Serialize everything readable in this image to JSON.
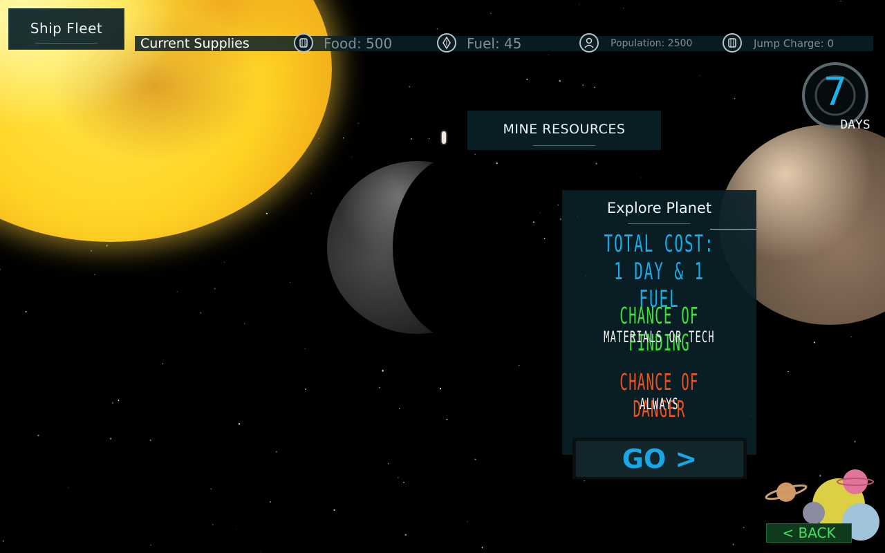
{
  "hud": {
    "ship_fleet_label": "Ship Fleet",
    "supplies_title": "Current Supplies",
    "food": "Food: 500",
    "fuel": "Fuel: 45",
    "population": "Population: 2500",
    "jump_charge": "Jump Charge: 0",
    "days_count": "7",
    "days_label": "DAYS"
  },
  "actions": {
    "mine_resources": "MINE RESOURCES"
  },
  "explore": {
    "title": "Explore Planet",
    "cost_line1": "TOTAL COST:",
    "cost_line2": "1 DAY & 1 FUEL",
    "finding_head": "CHANCE OF FINDING",
    "finding_sub": "MATERIALS OR TECH",
    "danger_head": "CHANCE OF DANGER",
    "danger_sub": "ALWAYS",
    "go_label": "GO >"
  },
  "nav": {
    "back_label": "< BACK"
  },
  "icons": {
    "food": "barrel-icon",
    "fuel": "fuel-drop-icon",
    "population": "person-icon",
    "jump_charge": "battery-icon"
  },
  "colors": {
    "panel": "#0a2028",
    "cost_text": "#15aee8",
    "finding_text": "#3ee33a",
    "danger_text": "#f0521e",
    "go_text": "#18a8e8",
    "back_text": "#3fe35e"
  }
}
